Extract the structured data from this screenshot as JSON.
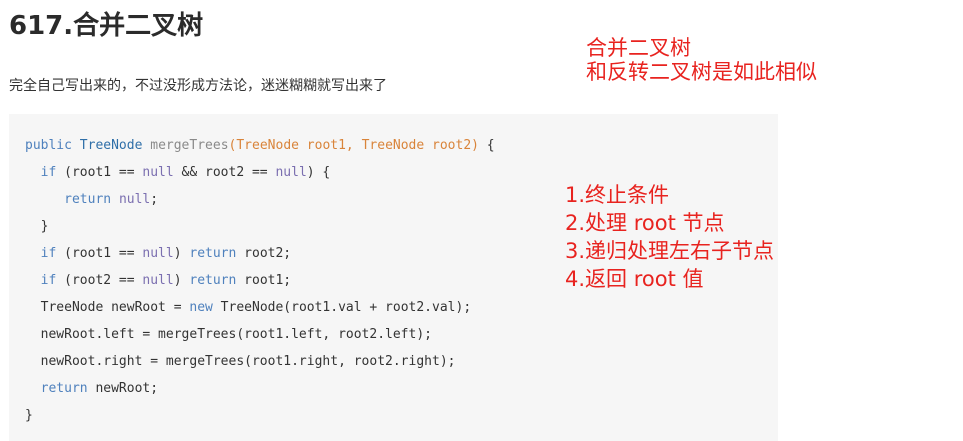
{
  "title": "617.合并二叉树",
  "intro": "完全自己写出来的，不过没形成方法论，迷迷糊糊就写出来了",
  "code": {
    "line1": {
      "kw": "public",
      "type": "TreeNode",
      "fn": "mergeTrees",
      "params": "(TreeNode root1, TreeNode root2)",
      "tail": " {"
    },
    "line2": {
      "kw": "if",
      "a": " (root1 == ",
      "null1": "null",
      "b": " && root2 == ",
      "null2": "null",
      "c": ") {"
    },
    "line3": {
      "kw": "return",
      "null": "null",
      "tail": ";"
    },
    "line4": {
      "text": "}"
    },
    "line5": {
      "kw": "if",
      "a": " (root1 == ",
      "null": "null",
      "b": ") ",
      "kw2": "return",
      "c": " root2;"
    },
    "line6": {
      "kw": "if",
      "a": " (root2 == ",
      "null": "null",
      "b": ") ",
      "kw2": "return",
      "c": " root1;"
    },
    "line7": {
      "a": "TreeNode newRoot = ",
      "kw": "new",
      "b": " TreeNode(root1.val + root2.val);"
    },
    "line8": {
      "text": "newRoot.left = mergeTrees(root1.left, root2.left);"
    },
    "line9": {
      "text": "newRoot.right = mergeTrees(root1.right, root2.right);"
    },
    "line10": {
      "kw": "return",
      "tail": " newRoot;"
    },
    "line11": {
      "text": "}"
    }
  },
  "notes": {
    "top_line1": "合并二叉树",
    "top_line2": "和反转二叉树是如此相似",
    "step1": "1.终止条件",
    "step2": "2.处理 root 节点",
    "step3": "3.递归处理左右子节点",
    "step4": "4.返回 root 值"
  },
  "colors": {
    "annotation": "#e8231f",
    "code_background": "#f6f6f6",
    "keyword": "#4f81bd",
    "param": "#d9843a"
  }
}
